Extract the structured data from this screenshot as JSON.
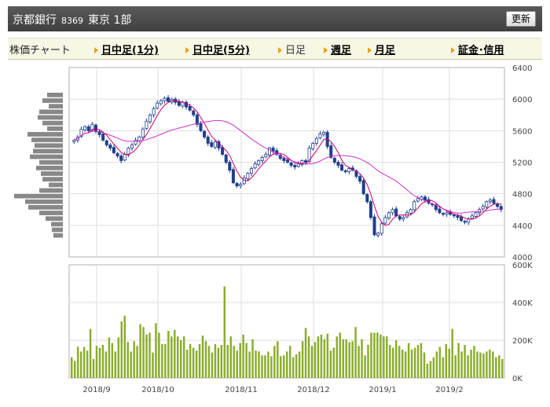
{
  "header": {
    "title": "京都銀行",
    "code": "8369",
    "market": "東京 1部",
    "refresh_label": "更新"
  },
  "nav": {
    "chart_label": "株価チャート",
    "items": [
      {
        "label": "日中足(1分)",
        "active": false
      },
      {
        "label": "日中足(5分)",
        "active": false
      },
      {
        "label": "日足",
        "active": true
      },
      {
        "label": "週足",
        "active": false
      },
      {
        "label": "月足",
        "active": false
      },
      {
        "label": "証金･信用",
        "active": false
      }
    ]
  },
  "chart_data": [
    {
      "type": "candlestick",
      "ylim": [
        4000,
        6400
      ],
      "yticks": [
        "6400",
        "6000",
        "5600",
        "5200",
        "4800",
        "4400",
        "4000"
      ],
      "xticks": [
        "2018/9",
        "2018/10",
        "2018/11",
        "2018/12",
        "2019/1",
        "2019/2"
      ],
      "colors": {
        "up": "#ffffff",
        "down": "#1f3f8f",
        "ma_short": "#cc0066",
        "ma_long": "#cc33cc",
        "volume_profile": "#888888"
      },
      "close": [
        5480,
        5520,
        5620,
        5650,
        5600,
        5680,
        5590,
        5550,
        5480,
        5420,
        5380,
        5320,
        5280,
        5220,
        5300,
        5380,
        5420,
        5480,
        5520,
        5620,
        5720,
        5800,
        5880,
        5950,
        5980,
        6010,
        5970,
        6000,
        5960,
        5920,
        5960,
        5900,
        5860,
        5800,
        5680,
        5600,
        5520,
        5440,
        5400,
        5460,
        5380,
        5300,
        5200,
        5100,
        4940,
        4900,
        4920,
        5000,
        5060,
        5120,
        5180,
        5220,
        5260,
        5300,
        5380,
        5340,
        5300,
        5250,
        5220,
        5200,
        5160,
        5140,
        5180,
        5220,
        5200,
        5380,
        5440,
        5500,
        5560,
        5580,
        5400,
        5260,
        5200,
        5160,
        5100,
        5080,
        5120,
        5100,
        5020,
        4960,
        4800,
        4700,
        4500,
        4280,
        4300,
        4420,
        4500,
        4560,
        4600,
        4520,
        4480,
        4500,
        4560,
        4600,
        4700,
        4740,
        4760,
        4720,
        4680,
        4660,
        4600,
        4560,
        4540,
        4560,
        4540,
        4520,
        4500,
        4460,
        4440,
        4480,
        4520,
        4560,
        4600,
        4640,
        4700,
        4720,
        4680,
        4640,
        4600
      ]
    },
    {
      "type": "bar",
      "title": "",
      "ylim": [
        0,
        600000
      ],
      "yticks": [
        "600K",
        "400K",
        "200K",
        "0K"
      ],
      "color": "#8aad2a",
      "values": [
        110000,
        90000,
        165000,
        140000,
        165000,
        145000,
        260000,
        100000,
        170000,
        160000,
        175000,
        140000,
        215000,
        185000,
        140000,
        215000,
        300000,
        330000,
        190000,
        140000,
        195000,
        170000,
        285000,
        270000,
        230000,
        240000,
        135000,
        290000,
        240000,
        180000,
        180000,
        250000,
        220000,
        255000,
        220000,
        200000,
        220000,
        150000,
        180000,
        160000,
        145000,
        180000,
        225000,
        195000,
        170000,
        135000,
        180000,
        160000,
        175000,
        485000,
        175000,
        220000,
        170000,
        145000,
        185000,
        230000,
        185000,
        140000,
        205000,
        145000,
        140000,
        120000,
        120000,
        140000,
        115000,
        170000,
        195000,
        115000,
        120000,
        140000,
        170000,
        110000,
        125000,
        140000,
        195000,
        265000,
        220000,
        170000,
        190000,
        220000,
        230000,
        205000,
        235000,
        145000,
        160000,
        220000,
        240000,
        205000,
        205000,
        190000,
        195000,
        270000,
        170000,
        205000,
        120000,
        175000,
        240000,
        240000,
        240000,
        230000,
        220000,
        220000,
        175000,
        160000,
        200000,
        170000,
        150000,
        140000,
        185000,
        150000,
        160000,
        175000,
        185000,
        135000,
        75000,
        90000,
        110000,
        140000,
        165000,
        110000,
        180000,
        155000,
        260000,
        120000,
        185000,
        140000,
        175000,
        120000,
        150000,
        170000,
        140000,
        135000,
        130000,
        140000,
        150000,
        140000,
        110000,
        120000,
        100000
      ]
    },
    {
      "type": "bar",
      "orientation": "horizontal",
      "values": [
        20,
        26,
        18,
        30,
        32,
        26,
        20,
        45,
        40,
        36,
        38,
        42,
        30,
        34,
        28,
        26,
        18,
        30,
        62,
        48,
        44,
        30,
        22,
        15,
        14,
        12
      ]
    }
  ]
}
